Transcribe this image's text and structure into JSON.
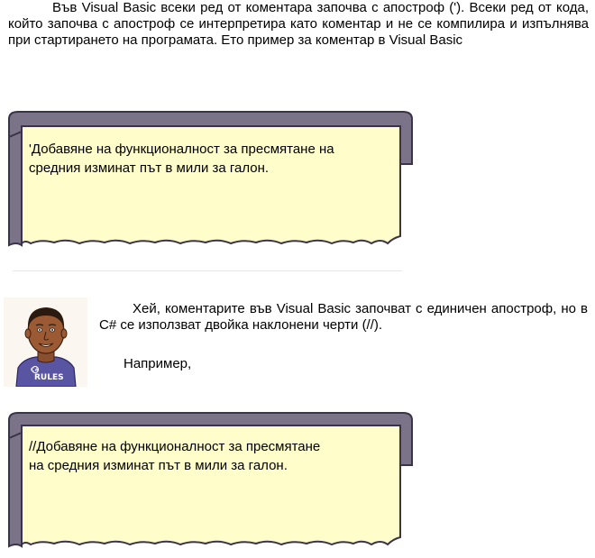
{
  "intro_paragraph": "Във Visual Basic всеки ред от коментара започва с апостроф ('). Всеки ред от кода, който започва с апостроф се интерпретира като коментар и не се компилира и изпълнява при стартирането на програмата. Ето пример за коментар в Visual Basic",
  "vb_example": {
    "line1": "'Добавяне на функционалност за пресмятане на",
    "line2": "средния изминат път в мили за галон."
  },
  "character_paragraph": "Хей, коментарите във Visual Basic започват с единичен апостроф, но в C# се използват двойка наклонени черти (//).",
  "example_label": "Например,",
  "csharp_example": {
    "line1": "//Добавяне на функционалност за пресмятане",
    "line2": "на средния изминат път в мили за галон."
  },
  "avatar": {
    "shirt_text": "C# RULES",
    "icon": "person-cartoon-icon"
  },
  "colors": {
    "frame": "#7b7489",
    "frame_dark": "#3b3348",
    "paper": "#fffdc9",
    "shirt": "#5a55a3"
  }
}
